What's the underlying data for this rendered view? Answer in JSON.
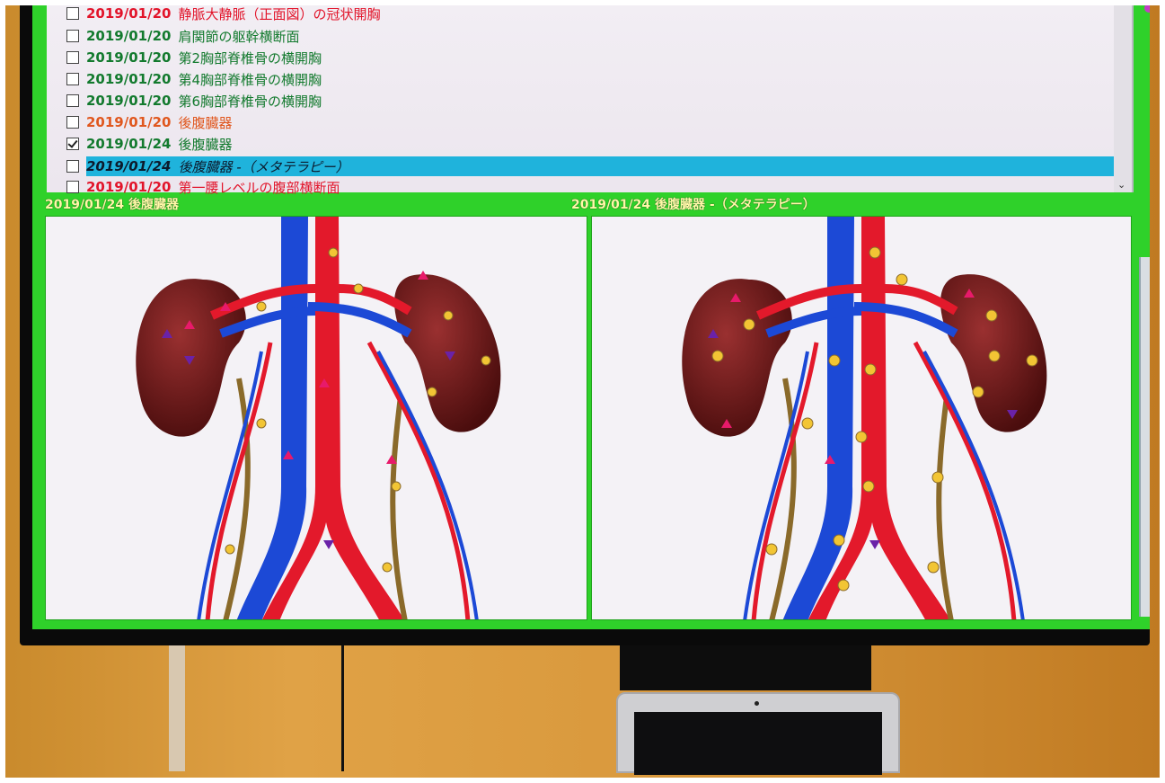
{
  "list": {
    "rows": [
      {
        "date": "2019/01/20",
        "text": "静脈大静脈（正面図）の冠状開胸",
        "color": "#e2142a",
        "checked": false,
        "selected": false
      },
      {
        "date": "2019/01/20",
        "text": "肩関節の躯幹横断面",
        "color": "#137a2e",
        "checked": false,
        "selected": false
      },
      {
        "date": "2019/01/20",
        "text": "第2胸部脊椎骨の横開胸",
        "color": "#137a2e",
        "checked": false,
        "selected": false
      },
      {
        "date": "2019/01/20",
        "text": "第4胸部脊椎骨の横開胸",
        "color": "#137a2e",
        "checked": false,
        "selected": false
      },
      {
        "date": "2019/01/20",
        "text": "第6胸部脊椎骨の横開胸",
        "color": "#137a2e",
        "checked": false,
        "selected": false
      },
      {
        "date": "2019/01/20",
        "text": "後腹臓器",
        "color": "#e0571e",
        "checked": false,
        "selected": false
      },
      {
        "date": "2019/01/24",
        "text": "後腹臓器",
        "color": "#137a2e",
        "checked": true,
        "selected": false
      },
      {
        "date": "2019/01/24",
        "text": "後腹臓器 -（メタテラピー）",
        "color": "#0c1a2c",
        "checked": false,
        "selected": true
      },
      {
        "date": "2019/01/20",
        "text": "第一腰レベルの腹部横断面",
        "color": "#e2142a",
        "checked": false,
        "selected": false
      }
    ]
  },
  "viewers": {
    "left": {
      "date": "2019/01/24",
      "title": "後腹臓器"
    },
    "right": {
      "date": "2019/01/24",
      "title": "後腹臓器 -（メタテラピー）"
    }
  },
  "colors": {
    "screen_green": "#2fd12a",
    "selection": "#1fb3dc",
    "caption": "#fff8a8",
    "artery": "#e3192b",
    "vein": "#1c49d6",
    "kidney": "#6a1414"
  },
  "icons": {
    "scroll_down": "chevron-down-icon",
    "checkbox": "checkbox-icon"
  }
}
